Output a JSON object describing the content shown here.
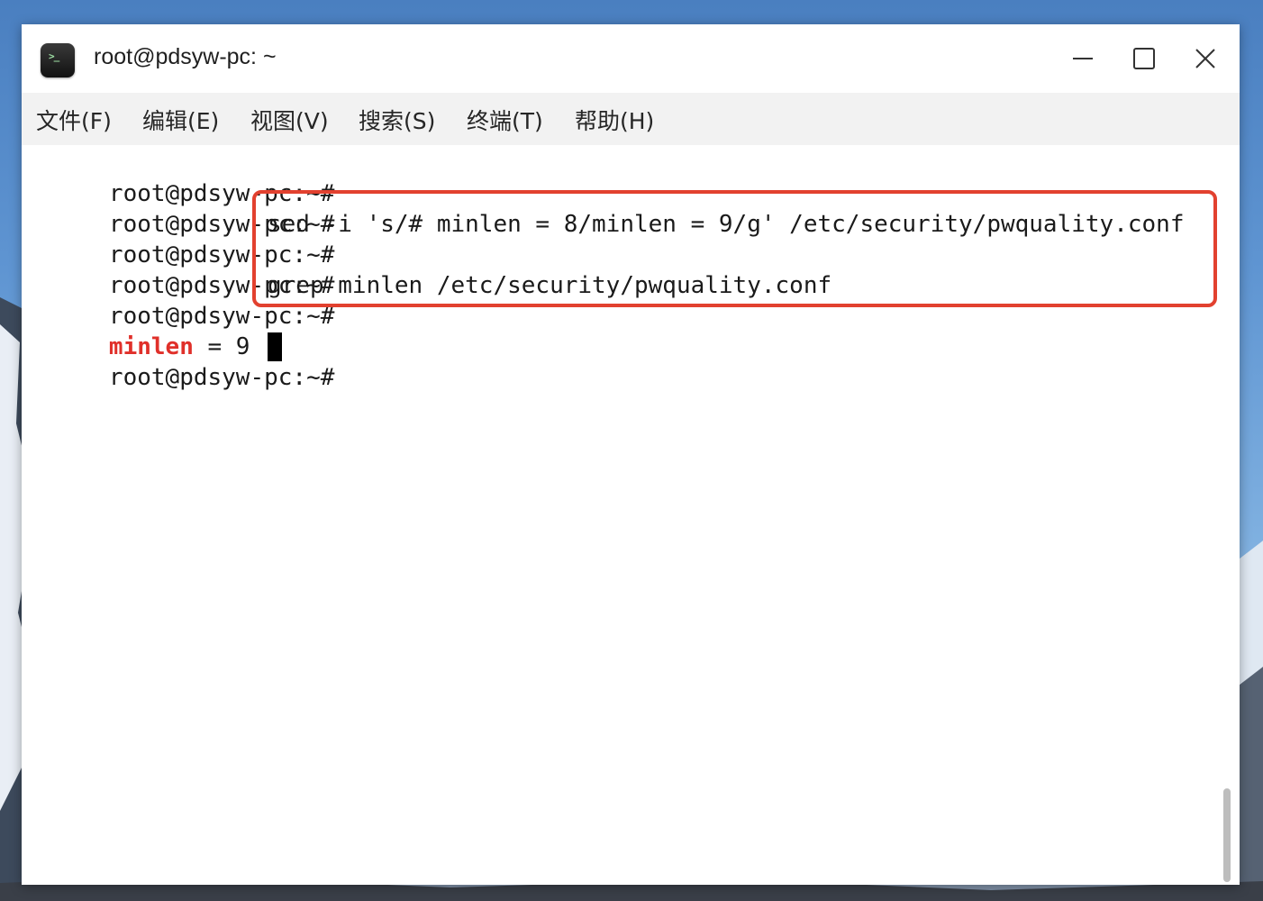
{
  "window": {
    "title": "root@pdsyw-pc: ~",
    "app_icon": "terminal-icon",
    "app_icon_glyph": ">_",
    "controls": [
      "minimize-icon",
      "maximize-icon",
      "close-icon"
    ]
  },
  "menu": {
    "items": [
      {
        "label": "文件(F)"
      },
      {
        "label": "编辑(E)"
      },
      {
        "label": "视图(V)"
      },
      {
        "label": "搜索(S)"
      },
      {
        "label": "终端(T)"
      },
      {
        "label": "帮助(H)"
      }
    ]
  },
  "terminal": {
    "prompt": "root@pdsyw-pc:~#",
    "prompt_spaced": "root@pdsyw-pc:~# ",
    "command_1": "sed -i 's/# minlen = 8/minlen = 9/g' /etc/security/pwquality.conf",
    "command_2": "grep minlen /etc/security/pwquality.conf",
    "output_key": "minlen",
    "output_rest": " = 9",
    "highlight_color": "#e0302a",
    "annotation_color": "#e2412f"
  }
}
